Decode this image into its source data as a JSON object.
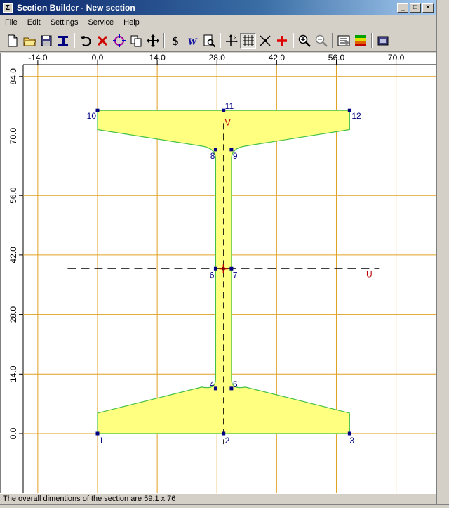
{
  "window": {
    "title": "Section Builder - New section"
  },
  "menu": [
    "File",
    "Edit",
    "Settings",
    "Service",
    "Help"
  ],
  "toolbar": {
    "buttons": [
      {
        "name": "new-file-icon"
      },
      {
        "name": "open-folder-icon"
      },
      {
        "name": "save-icon"
      },
      {
        "name": "i-beam-section-icon"
      },
      {
        "sep": true
      },
      {
        "name": "undo-icon"
      },
      {
        "name": "delete-icon"
      },
      {
        "name": "move-target-icon"
      },
      {
        "name": "copy-icon"
      },
      {
        "name": "move-arrows-icon"
      },
      {
        "sep": true
      },
      {
        "name": "dollar-icon"
      },
      {
        "name": "w-icon"
      },
      {
        "name": "preview-icon"
      },
      {
        "sep": true
      },
      {
        "name": "axes-icon"
      },
      {
        "name": "grid-icon",
        "pressed": true
      },
      {
        "name": "snap-icon"
      },
      {
        "name": "add-point-icon"
      },
      {
        "sep": true
      },
      {
        "name": "zoom-in-icon"
      },
      {
        "name": "zoom-out-icon"
      },
      {
        "sep": true
      },
      {
        "name": "properties-icon"
      },
      {
        "name": "color-map-icon"
      },
      {
        "sep": true
      },
      {
        "name": "options-icon"
      }
    ]
  },
  "axes": {
    "x_ticks": [
      "-14.0",
      "0.0",
      "14.0",
      "28.0",
      "42.0",
      "56.0",
      "70.0"
    ],
    "y_ticks": [
      "84.0",
      "70.0",
      "56.0",
      "42.0",
      "28.0",
      "14.0",
      "0.0"
    ]
  },
  "section": {
    "points": [
      {
        "id": "1",
        "x": 0.0,
        "y": 0.0
      },
      {
        "id": "2",
        "x": 29.55,
        "y": 0.0
      },
      {
        "id": "3",
        "x": 59.1,
        "y": 0.0
      },
      {
        "id": "4",
        "x": 27.7,
        "y": 10.6
      },
      {
        "id": "5",
        "x": 31.4,
        "y": 10.6
      },
      {
        "id": "6",
        "x": 27.7,
        "y": 38.8
      },
      {
        "id": "7",
        "x": 31.4,
        "y": 38.8
      },
      {
        "id": "8",
        "x": 27.7,
        "y": 66.8
      },
      {
        "id": "9",
        "x": 31.4,
        "y": 66.8
      },
      {
        "id": "10",
        "x": 0.0,
        "y": 76.0
      },
      {
        "id": "11",
        "x": 29.55,
        "y": 76.0
      },
      {
        "id": "12",
        "x": 59.1,
        "y": 76.0
      }
    ],
    "axis_labels": {
      "vertical": "V",
      "horizontal": "U"
    },
    "colors": {
      "fill": "#ffff80",
      "outline": "#44c044",
      "grid": "#e0a020",
      "point": "#000080",
      "label": "#000080",
      "axis_label": "#c00000"
    }
  },
  "status": {
    "text": "The overall dimentions of the section are 59.1 x 76"
  }
}
